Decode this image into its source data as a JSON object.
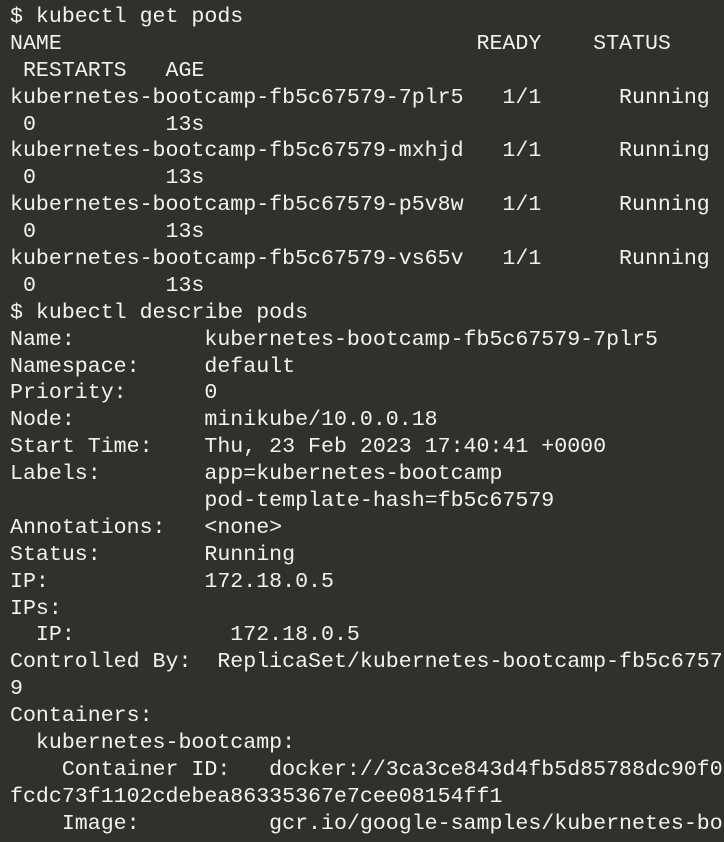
{
  "terminal": {
    "background": "#31302b",
    "foreground": "#f2f2f2",
    "lines": [
      "$ kubectl get pods",
      "NAME                                READY    STATUS",
      " RESTARTS   AGE",
      "kubernetes-bootcamp-fb5c67579-7plr5   1/1      Running",
      " 0          13s",
      "kubernetes-bootcamp-fb5c67579-mxhjd   1/1      Running",
      " 0          13s",
      "kubernetes-bootcamp-fb5c67579-p5v8w   1/1      Running",
      " 0          13s",
      "kubernetes-bootcamp-fb5c67579-vs65v   1/1      Running",
      " 0          13s",
      "$ kubectl describe pods",
      "Name:          kubernetes-bootcamp-fb5c67579-7plr5",
      "Namespace:     default",
      "Priority:      0",
      "Node:          minikube/10.0.0.18",
      "Start Time:    Thu, 23 Feb 2023 17:40:41 +0000",
      "Labels:        app=kubernetes-bootcamp",
      "               pod-template-hash=fb5c67579",
      "Annotations:   <none>",
      "Status:        Running",
      "IP:            172.18.0.5",
      "IPs:",
      "  IP:            172.18.0.5",
      "Controlled By:  ReplicaSet/kubernetes-bootcamp-fb5c6757",
      "9",
      "Containers:",
      "  kubernetes-bootcamp:",
      "    Container ID:   docker://3ca3ce843d4fb5d85788dc90f0",
      "fcdc73f1102cdebea86335367e7cee08154ff1",
      "    Image:          gcr.io/google-samples/kubernetes-bo"
    ]
  }
}
